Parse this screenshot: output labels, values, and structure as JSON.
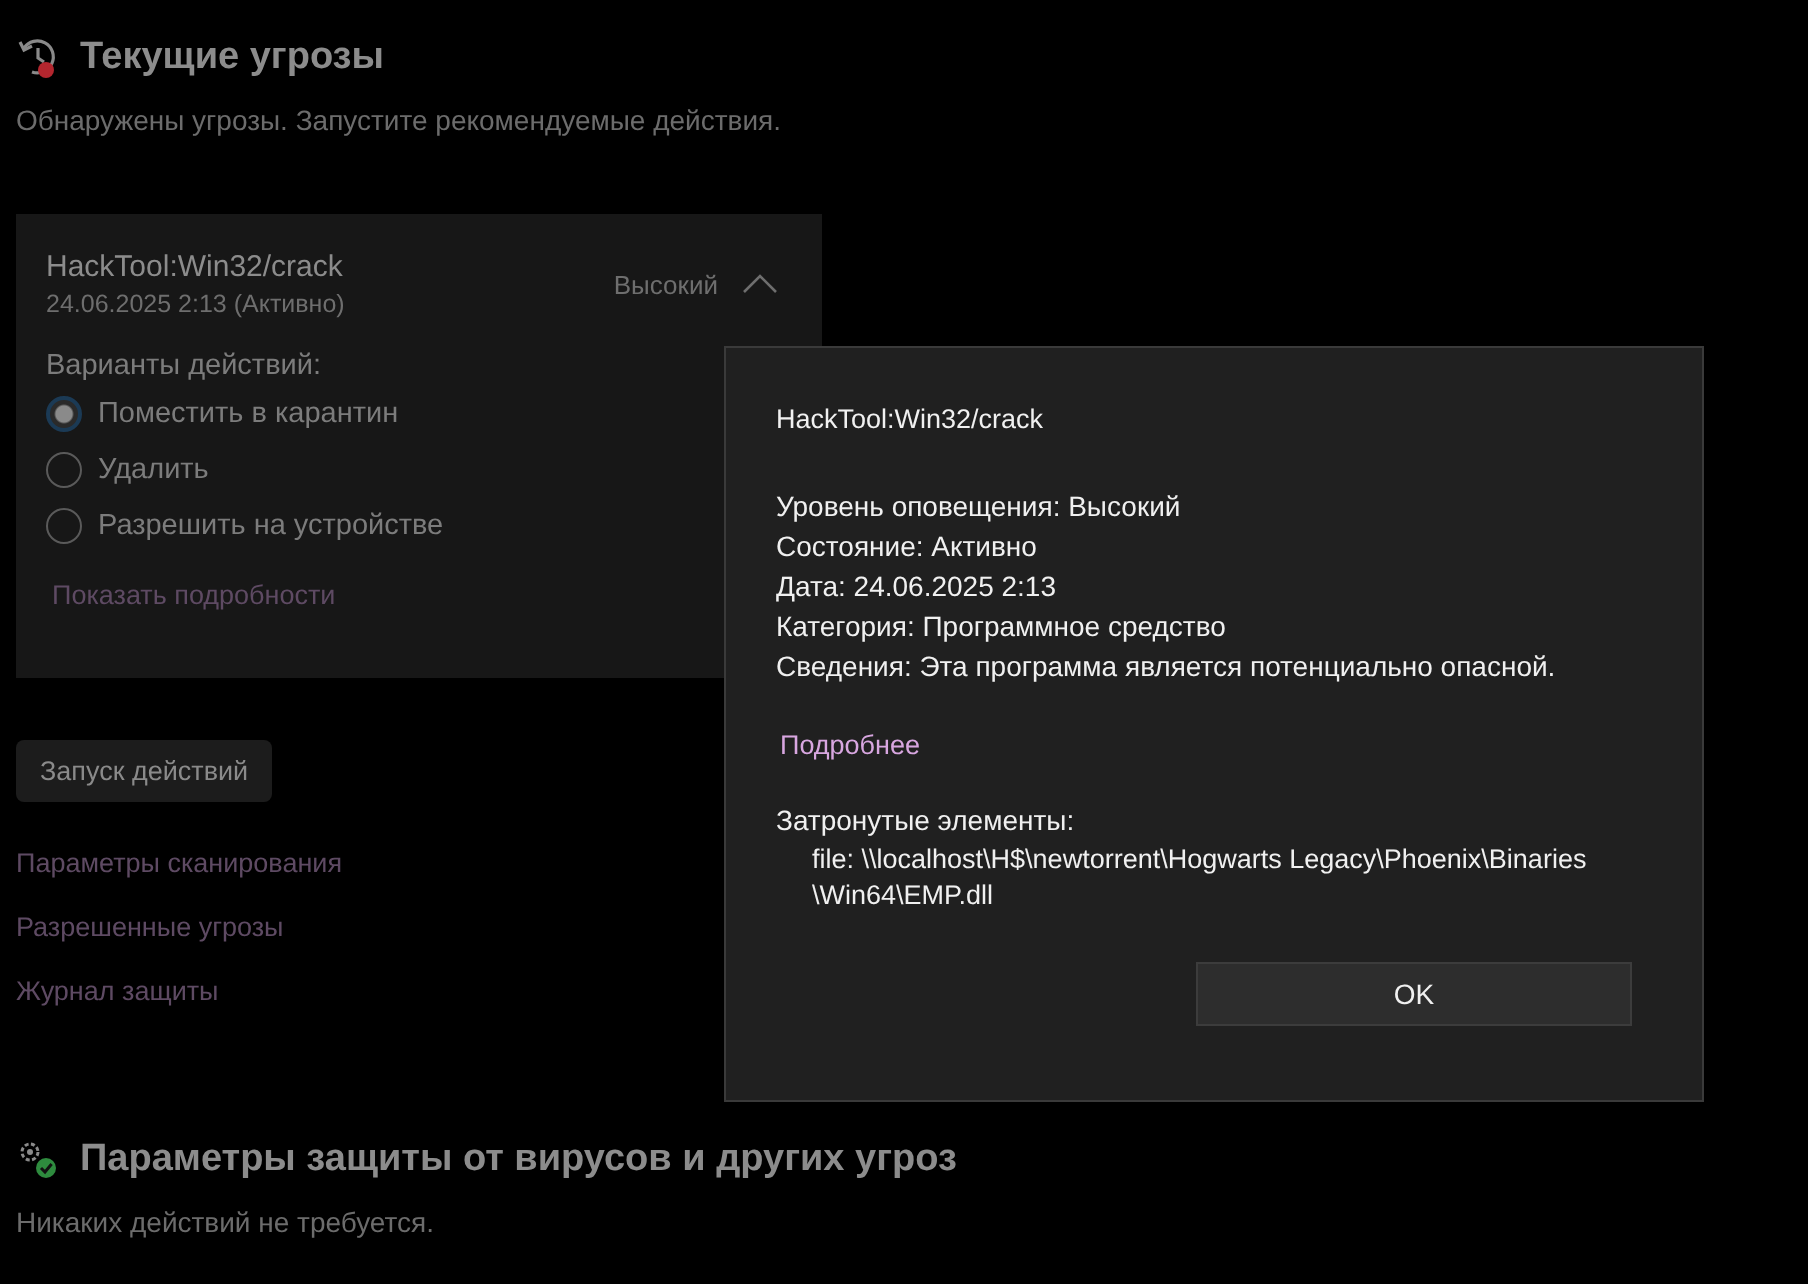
{
  "current_threats": {
    "title": "Текущие угрозы",
    "subtitle": "Обнаружены угрозы. Запустите рекомендуемые действия.",
    "threat": {
      "name": "HackTool:Win32/crack",
      "date": "24.06.2025 2:13 (Активно)",
      "severity": "Высокий",
      "expanded": true,
      "actions_label": "Варианты действий:",
      "actions": [
        {
          "label": "Поместить в карантин",
          "selected": true
        },
        {
          "label": "Удалить",
          "selected": false
        },
        {
          "label": "Разрешить на устройстве",
          "selected": false
        }
      ],
      "details_link": "Показать подробности"
    },
    "start_button": "Запуск действий",
    "links": [
      "Параметры сканирования",
      "Разрешенные угрозы",
      "Журнал защиты"
    ]
  },
  "protection_settings": {
    "title": "Параметры защиты от вирусов и других угроз",
    "subtitle": "Никаких действий не требуется."
  },
  "dialog": {
    "title": "HackTool:Win32/crack",
    "details": [
      "Уровень оповещения: Высокий",
      "Состояние: Активно",
      "Дата: 24.06.2025 2:13",
      "Категория: Программное средство",
      "Сведения: Эта программа является потенциально опасной."
    ],
    "more_link": "Подробнее",
    "affected_label": "Затронутые элементы:",
    "affected_lines": [
      "file: \\\\localhost\\H$\\newtorrent\\Hogwarts Legacy\\Phoenix\\Binaries",
      "\\Win64\\EMP.dll"
    ],
    "ok_button": "OK"
  }
}
